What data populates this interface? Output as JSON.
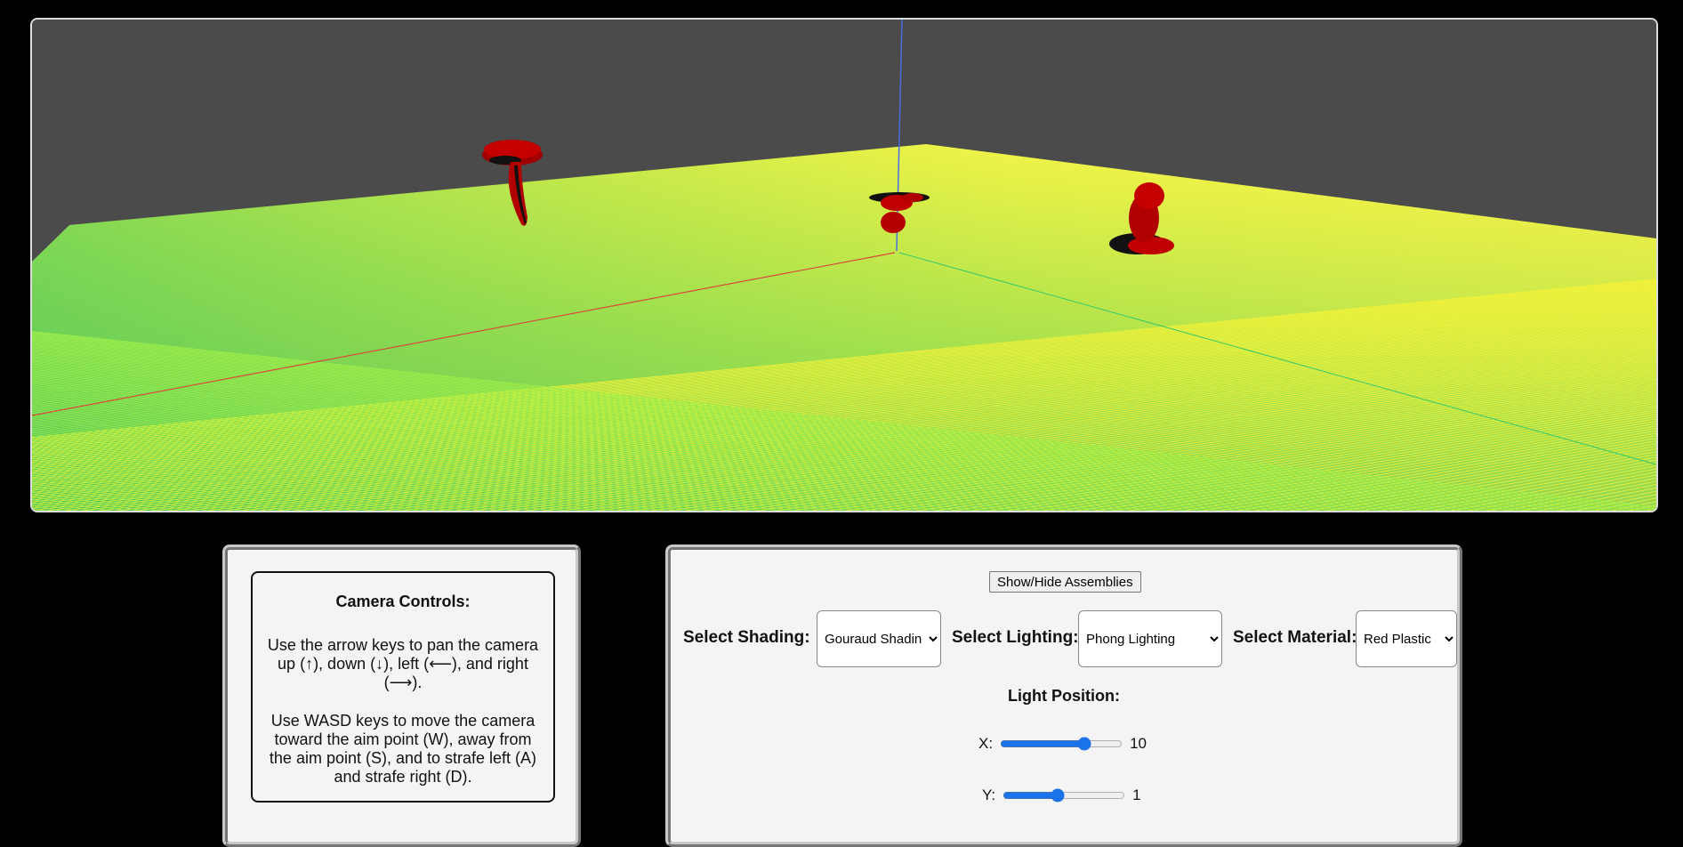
{
  "scene": {
    "background_color": "#4b4b4b",
    "floor_color_near": "#3fbd5a",
    "floor_color_far": "#e6f046",
    "object_color": "#b50000"
  },
  "camera_controls": {
    "title": "Camera Controls:",
    "pan_text": "Use the arrow keys to pan the camera up (↑), down (↓), left (⟵), and right (⟶).",
    "move_text": "Use WASD keys to move the camera toward the aim point (W), away from the aim point (S), and to strafe left (A) and strafe right (D)."
  },
  "settings": {
    "toggle_button_label": "Show/Hide Assemblies",
    "shading_label": "Select Shading:",
    "shading_value": "Gouraud Shading",
    "lighting_label": "Select Lighting:",
    "lighting_value": "Phong Lighting",
    "material_label": "Select Material:",
    "material_value": "Red Plastic",
    "light_position_title": "Light Position:",
    "x_label": "X:",
    "x_value": "10",
    "y_label": "Y:",
    "y_value": "1"
  }
}
